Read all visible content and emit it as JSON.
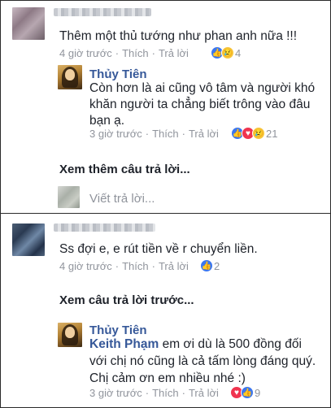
{
  "comments": {
    "c1": {
      "text": "Thêm một thủ tướng như phan anh nữa !!!",
      "time": "4 giờ trước",
      "like": "Thích",
      "reply": "Trả lời",
      "react_count": "4"
    },
    "r1": {
      "name": "Thủy Tiên",
      "line1": "Còn hơn là ai cũng vô tâm và người khó",
      "line2": "khăn người ta chẳng biết trông vào đâu",
      "line3": "bạn ạ.",
      "time": "3 giờ trước",
      "like": "Thích",
      "reply": "Trả lời",
      "react_count": "21"
    },
    "more_replies": "Xem thêm câu trả lời...",
    "reply_placeholder": "Viết trả lời...",
    "c2": {
      "text": "Ss đợi e, e rút tiền về r chuyển liền.",
      "time": "4 giờ trước",
      "like": "Thích",
      "reply": "Trả lời",
      "react_count": "2"
    },
    "prev_replies": "Xem câu trả lời trước...",
    "r2": {
      "name": "Thủy Tiên",
      "tag": "Keith Phạm",
      "line1_rest": "em ơi dù là 500 đồng đối",
      "line2": "với chị nó cũng là cả tấm lòng đáng quý.",
      "line3": "Chị cảm ơn em nhiều nhé :)",
      "time": "3 giờ trước",
      "like": "Thích",
      "reply": "Trả lời",
      "react_count": "9"
    }
  },
  "icons": {
    "like": "like-reaction-icon",
    "sad": "sad-reaction-icon",
    "love": "love-reaction-icon"
  },
  "colors": {
    "link_blue": "#365899",
    "meta_gray": "#90949c",
    "like_blue": "#3b77f0",
    "love_red": "#f0344f",
    "sad_yellow": "#f7c63b"
  }
}
